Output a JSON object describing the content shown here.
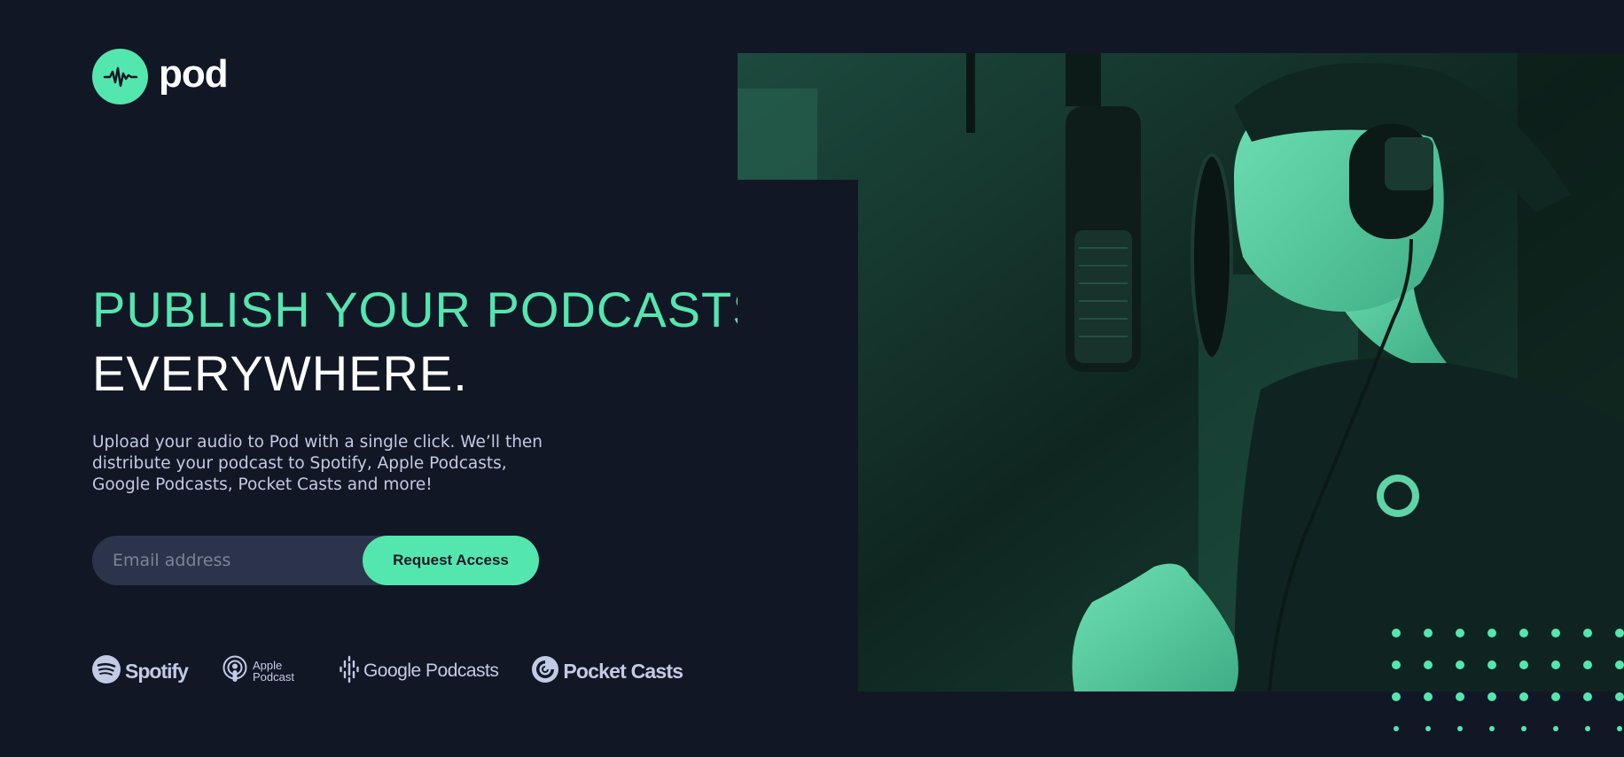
{
  "brand": {
    "name": "pod"
  },
  "hero": {
    "title_line1": "PUBLISH YOUR PODCASTS",
    "title_line2": "EVERYWHERE.",
    "description": "Upload your audio to Pod with a single click. We’ll then distribute your podcast to Spotify, Apple Podcasts, Google Podcasts, Pocket Casts and more!"
  },
  "signup": {
    "email_placeholder": "Email address",
    "button_label": "Request Access"
  },
  "platforms": [
    {
      "name": "Spotify",
      "icon": "spotify-icon"
    },
    {
      "name": "Apple Podcast",
      "icon": "apple-podcast-icon"
    },
    {
      "name": "Google Podcasts",
      "icon": "google-podcasts-icon"
    },
    {
      "name": "Pocket Casts",
      "icon": "pocket-casts-icon"
    }
  ],
  "colors": {
    "background": "#121725",
    "accent": "#54e6af",
    "text_light": "#c2cbe5",
    "input_bg": "#2c344b"
  }
}
